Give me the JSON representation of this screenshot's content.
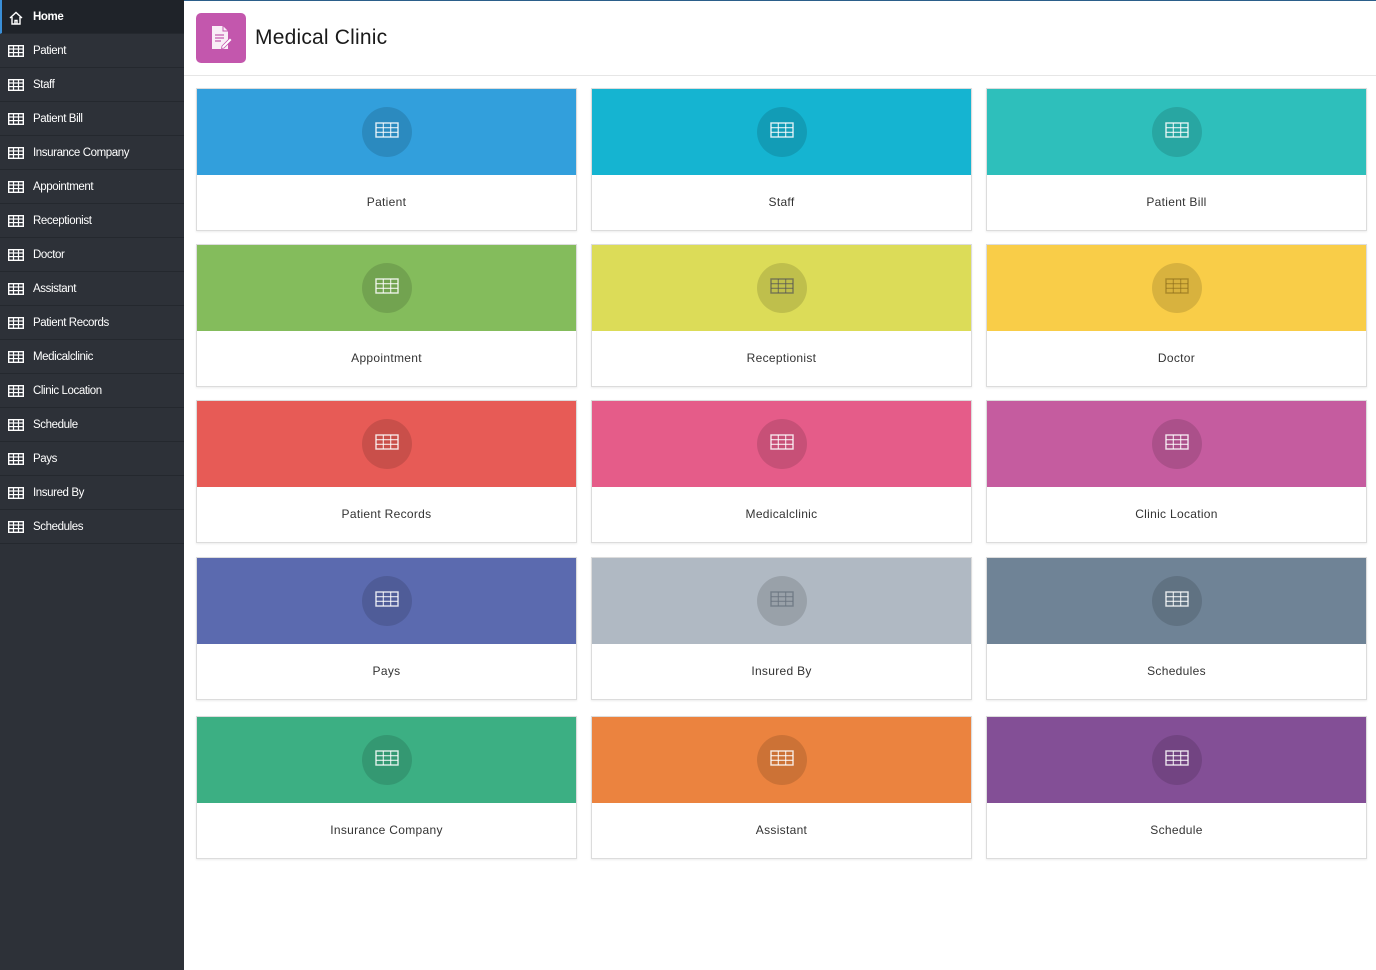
{
  "sidebar": {
    "items": [
      {
        "label": "Home",
        "icon": "home-icon"
      },
      {
        "label": "Patient",
        "icon": "table-icon"
      },
      {
        "label": "Staff",
        "icon": "table-icon"
      },
      {
        "label": "Patient Bill",
        "icon": "table-icon"
      },
      {
        "label": "Insurance Company",
        "icon": "table-icon"
      },
      {
        "label": "Appointment",
        "icon": "table-icon"
      },
      {
        "label": "Receptionist",
        "icon": "table-icon"
      },
      {
        "label": "Doctor",
        "icon": "table-icon"
      },
      {
        "label": "Assistant",
        "icon": "table-icon"
      },
      {
        "label": "Patient Records",
        "icon": "table-icon"
      },
      {
        "label": "Medicalclinic",
        "icon": "table-icon"
      },
      {
        "label": "Clinic Location",
        "icon": "table-icon"
      },
      {
        "label": "Schedule",
        "icon": "table-icon"
      },
      {
        "label": "Pays",
        "icon": "table-icon"
      },
      {
        "label": "Insured By",
        "icon": "table-icon"
      },
      {
        "label": "Schedules",
        "icon": "table-icon"
      }
    ]
  },
  "header": {
    "title": "Medical Clinic",
    "icon": "document-edit-icon",
    "icon_color": "#c357ad"
  },
  "cards": [
    {
      "label": "Patient",
      "color": "#329fdc"
    },
    {
      "label": "Staff",
      "color": "#15b4d1"
    },
    {
      "label": "Patient Bill",
      "color": "#2ebfbb"
    },
    {
      "label": "Appointment",
      "color": "#84bc5c"
    },
    {
      "label": "Receptionist",
      "color": "#dcdc58"
    },
    {
      "label": "Doctor",
      "color": "#f9cd48"
    },
    {
      "label": "Patient Records",
      "color": "#e75b56"
    },
    {
      "label": "Medicalclinic",
      "color": "#e55c89"
    },
    {
      "label": "Clinic Location",
      "color": "#c55c9f"
    },
    {
      "label": "Pays",
      "color": "#5b6aaf"
    },
    {
      "label": "Insured By",
      "color": "#b0b9c3"
    },
    {
      "label": "Schedules",
      "color": "#6f8396"
    },
    {
      "label": "Insurance Company",
      "color": "#3caf83"
    },
    {
      "label": "Assistant",
      "color": "#eb833f"
    },
    {
      "label": "Schedule",
      "color": "#834f96"
    }
  ]
}
